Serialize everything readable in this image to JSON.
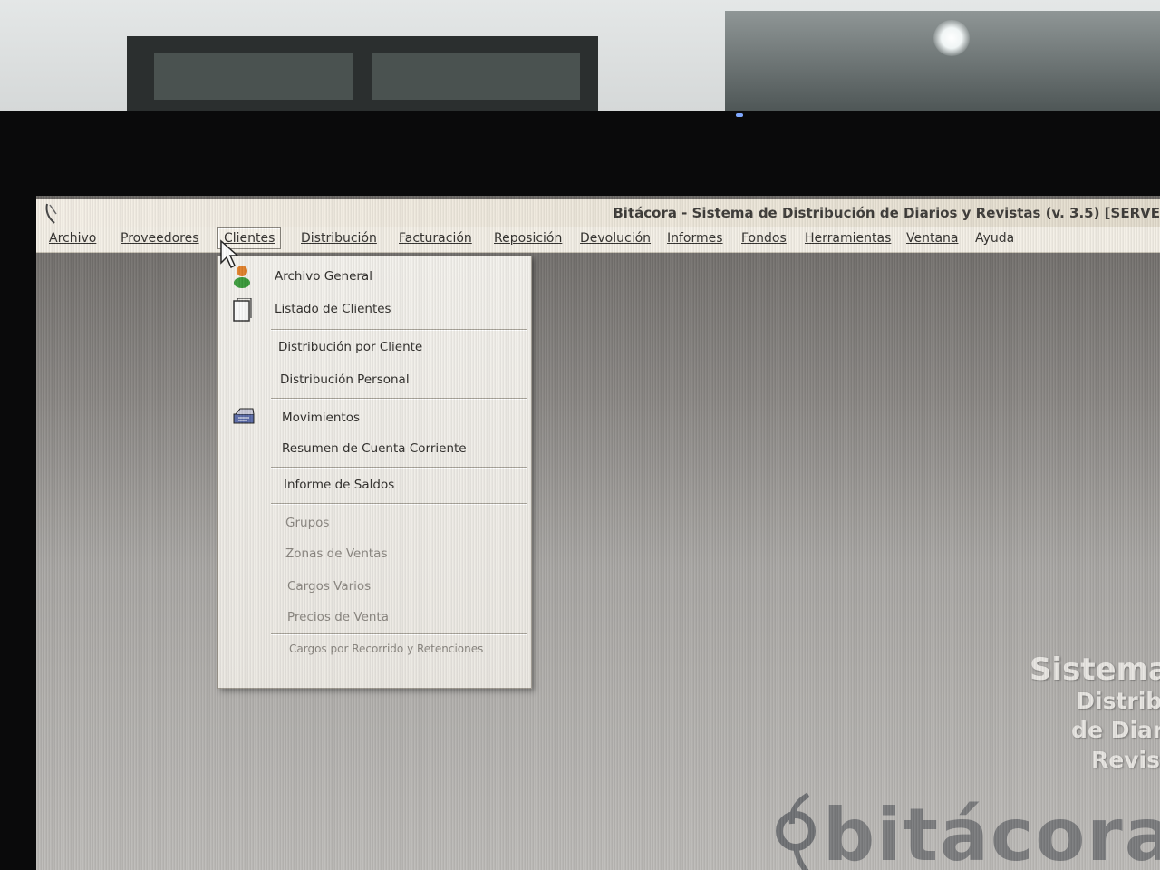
{
  "window": {
    "title": "Bitácora - Sistema de Distribución de Diarios y Revistas (v. 3.5) [SERVE"
  },
  "menubar": {
    "items": [
      {
        "label": "Archivo"
      },
      {
        "label": "Proveedores"
      },
      {
        "label": "Clientes",
        "active": true
      },
      {
        "label": "Distribución"
      },
      {
        "label": "Facturación"
      },
      {
        "label": "Reposición"
      },
      {
        "label": "Devolución"
      },
      {
        "label": "Informes"
      },
      {
        "label": "Fondos"
      },
      {
        "label": "Herramientas"
      },
      {
        "label": "Ventana"
      },
      {
        "label": "Ayuda"
      }
    ]
  },
  "clientes_menu": {
    "items": [
      {
        "label": "Archivo General",
        "icon": "person-icon",
        "enabled": true
      },
      {
        "label": "Listado de Clientes",
        "icon": "document-icon",
        "enabled": true
      },
      {
        "label": "Distribución por Cliente",
        "enabled": true
      },
      {
        "label": "Distribución Personal",
        "enabled": true
      },
      {
        "label": "Movimientos",
        "icon": "ledger-icon",
        "enabled": true
      },
      {
        "label": "Resumen de Cuenta Corriente",
        "enabled": true
      },
      {
        "label": "Informe de Saldos",
        "enabled": true
      },
      {
        "label": "Grupos",
        "enabled": false
      },
      {
        "label": "Zonas de Ventas",
        "enabled": false
      },
      {
        "label": "Cargos Varios",
        "enabled": false
      },
      {
        "label": "Precios de Venta",
        "enabled": false
      },
      {
        "label": "Cargos por Recorrido y Retenciones",
        "enabled": false
      }
    ]
  },
  "splash": {
    "line1": "Sistema",
    "line2": "Distribu",
    "line3": "de Diario",
    "line4": "Revis",
    "logo_text": "bitácora"
  },
  "colors": {
    "menu_bg": "#f3efe6",
    "desktop_gradient_top": "#6b6865",
    "desktop_gradient_bottom": "#bdbbb8",
    "logo_gray": "#7a7b7d"
  }
}
